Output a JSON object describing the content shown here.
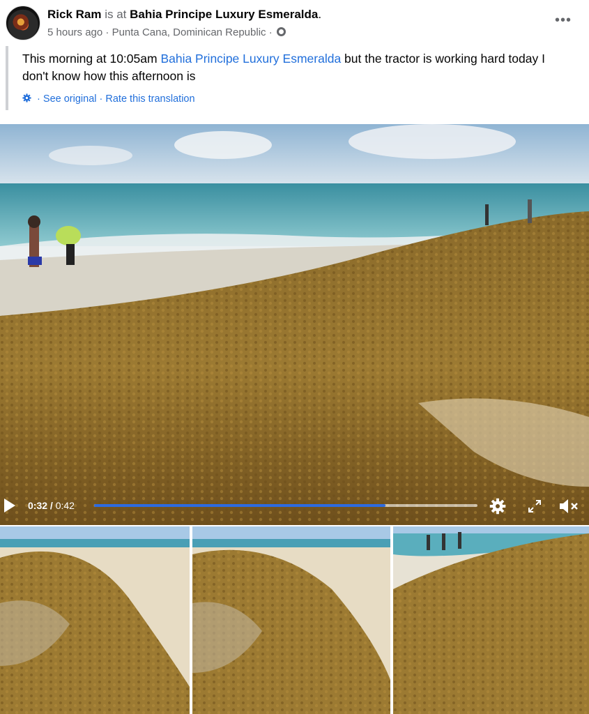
{
  "post": {
    "author": "Rick Ram",
    "is_at": "is at",
    "place": "Bahia Principe Luxury Esmeralda",
    "period": ".",
    "time": "5 hours ago",
    "location": "Punta Cana, Dominican Republic",
    "sep": "·",
    "more": "•••",
    "text_before": "This morning at 10:05am ",
    "text_link": "Bahia Principe Luxury Esmeralda",
    "text_after": " but the tractor is working hard today I don't know how this afternoon is",
    "see_original": "See original",
    "rate_translation": "Rate this translation"
  },
  "video": {
    "current_time": "0:32",
    "total_time": "0:42",
    "progress": 0.76,
    "icons": [
      "play-icon",
      "settings-icon",
      "fullscreen-icon",
      "mute-icon"
    ]
  },
  "colors": {
    "link": "#216fdb",
    "secondary": "#65676b",
    "progress": "#2d6be0"
  }
}
